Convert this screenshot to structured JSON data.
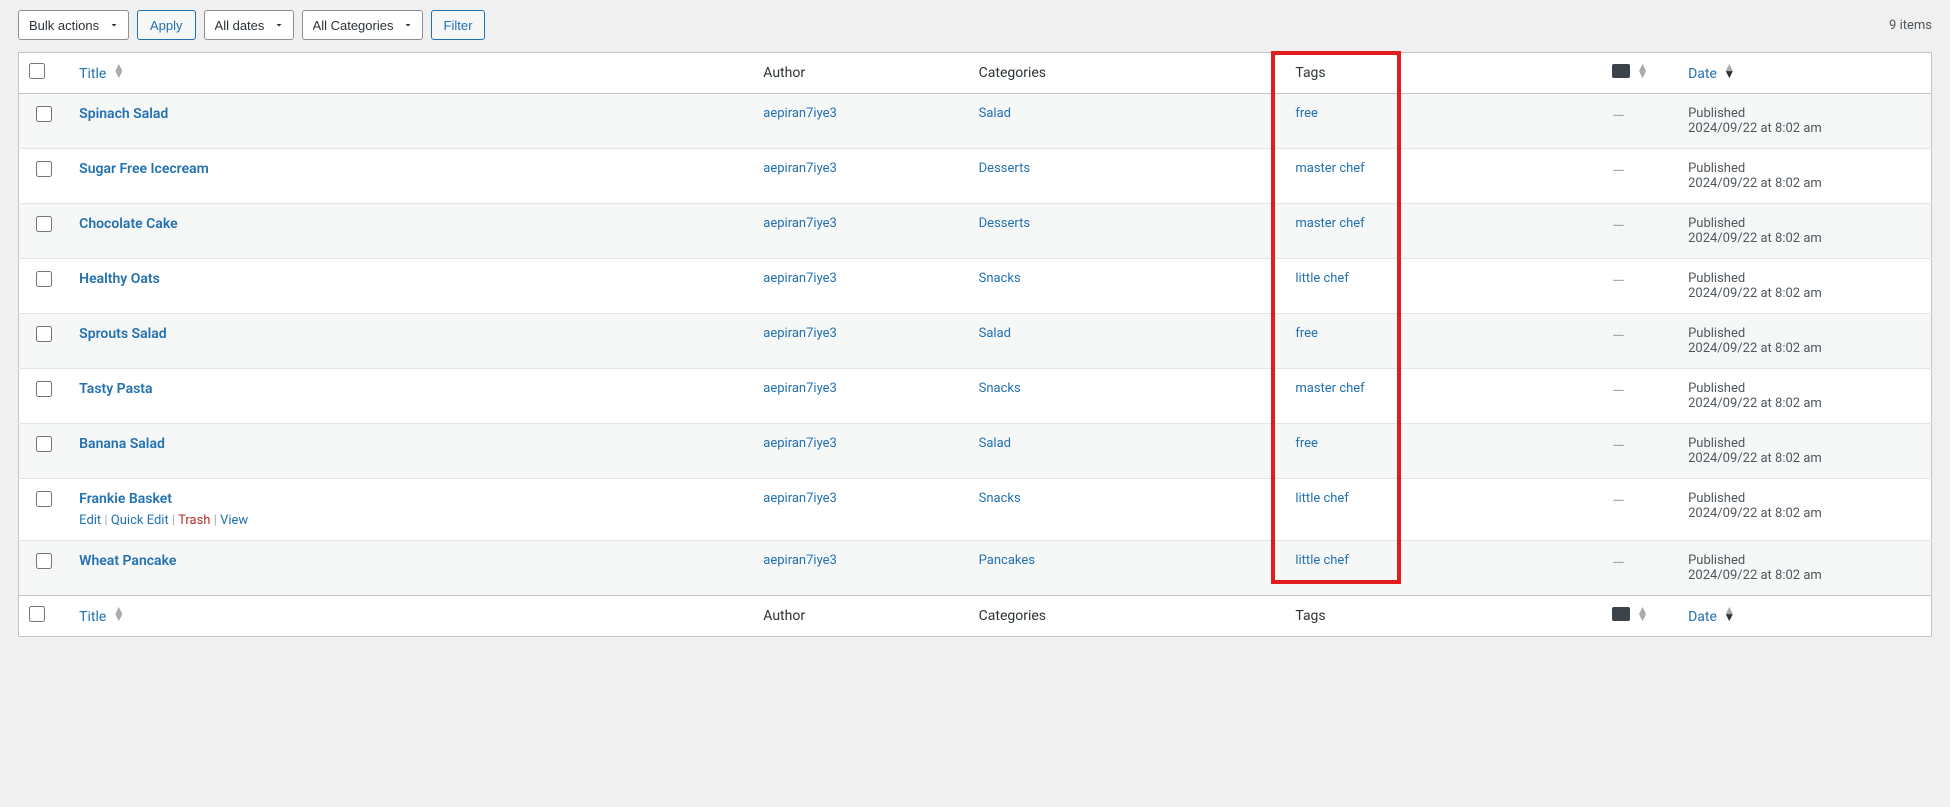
{
  "filters": {
    "bulk_actions": "Bulk actions",
    "apply": "Apply",
    "all_dates": "All dates",
    "all_categories": "All Categories",
    "filter": "Filter"
  },
  "items_count": "9 items",
  "columns": {
    "title": "Title",
    "author": "Author",
    "categories": "Categories",
    "tags": "Tags",
    "date": "Date"
  },
  "row_actions": {
    "edit": "Edit",
    "quick_edit": "Quick Edit",
    "trash": "Trash",
    "view": "View"
  },
  "published_label": "Published",
  "dash": "—",
  "rows": [
    {
      "title": "Spinach Salad",
      "author": "aepiran7iye3",
      "category": "Salad",
      "tag": "free",
      "date": "2024/09/22 at 8:02 am",
      "show_actions": false
    },
    {
      "title": "Sugar Free Icecream",
      "author": "aepiran7iye3",
      "category": "Desserts",
      "tag": "master chef",
      "date": "2024/09/22 at 8:02 am",
      "show_actions": false
    },
    {
      "title": "Chocolate Cake",
      "author": "aepiran7iye3",
      "category": "Desserts",
      "tag": "master chef",
      "date": "2024/09/22 at 8:02 am",
      "show_actions": false
    },
    {
      "title": "Healthy Oats",
      "author": "aepiran7iye3",
      "category": "Snacks",
      "tag": "little chef",
      "date": "2024/09/22 at 8:02 am",
      "show_actions": false
    },
    {
      "title": "Sprouts Salad",
      "author": "aepiran7iye3",
      "category": "Salad",
      "tag": "free",
      "date": "2024/09/22 at 8:02 am",
      "show_actions": false
    },
    {
      "title": "Tasty Pasta",
      "author": "aepiran7iye3",
      "category": "Snacks",
      "tag": "master chef",
      "date": "2024/09/22 at 8:02 am",
      "show_actions": false
    },
    {
      "title": "Banana Salad",
      "author": "aepiran7iye3",
      "category": "Salad",
      "tag": "free",
      "date": "2024/09/22 at 8:02 am",
      "show_actions": false
    },
    {
      "title": "Frankie Basket",
      "author": "aepiran7iye3",
      "category": "Snacks",
      "tag": "little chef",
      "date": "2024/09/22 at 8:02 am",
      "show_actions": true
    },
    {
      "title": "Wheat Pancake",
      "author": "aepiran7iye3",
      "category": "Pancakes",
      "tag": "little chef",
      "date": "2024/09/22 at 8:02 am",
      "show_actions": false
    }
  ]
}
